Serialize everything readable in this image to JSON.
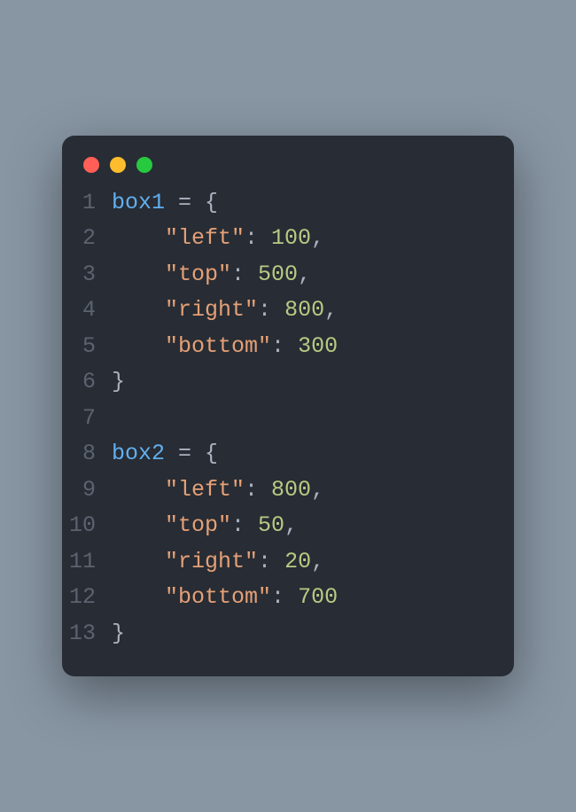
{
  "titlebar": {
    "buttons": [
      "close",
      "minimize",
      "zoom"
    ]
  },
  "code": {
    "lines": [
      {
        "n": "1",
        "tokens": [
          {
            "t": "box1",
            "c": "var"
          },
          {
            "t": " = ",
            "c": "op"
          },
          {
            "t": "{",
            "c": "brace"
          }
        ]
      },
      {
        "n": "2",
        "tokens": [
          {
            "t": "    ",
            "c": "op"
          },
          {
            "t": "\"left\"",
            "c": "str"
          },
          {
            "t": ": ",
            "c": "punc"
          },
          {
            "t": "100",
            "c": "num"
          },
          {
            "t": ",",
            "c": "punc"
          }
        ]
      },
      {
        "n": "3",
        "tokens": [
          {
            "t": "    ",
            "c": "op"
          },
          {
            "t": "\"top\"",
            "c": "str"
          },
          {
            "t": ": ",
            "c": "punc"
          },
          {
            "t": "500",
            "c": "num"
          },
          {
            "t": ",",
            "c": "punc"
          }
        ]
      },
      {
        "n": "4",
        "tokens": [
          {
            "t": "    ",
            "c": "op"
          },
          {
            "t": "\"right\"",
            "c": "str"
          },
          {
            "t": ": ",
            "c": "punc"
          },
          {
            "t": "800",
            "c": "num"
          },
          {
            "t": ",",
            "c": "punc"
          }
        ]
      },
      {
        "n": "5",
        "tokens": [
          {
            "t": "    ",
            "c": "op"
          },
          {
            "t": "\"bottom\"",
            "c": "str"
          },
          {
            "t": ": ",
            "c": "punc"
          },
          {
            "t": "300",
            "c": "num"
          }
        ]
      },
      {
        "n": "6",
        "tokens": [
          {
            "t": "}",
            "c": "brace"
          }
        ]
      },
      {
        "n": "7",
        "tokens": []
      },
      {
        "n": "8",
        "tokens": [
          {
            "t": "box2",
            "c": "var"
          },
          {
            "t": " = ",
            "c": "op"
          },
          {
            "t": "{",
            "c": "brace"
          }
        ]
      },
      {
        "n": "9",
        "tokens": [
          {
            "t": "    ",
            "c": "op"
          },
          {
            "t": "\"left\"",
            "c": "str"
          },
          {
            "t": ": ",
            "c": "punc"
          },
          {
            "t": "800",
            "c": "num"
          },
          {
            "t": ",",
            "c": "punc"
          }
        ]
      },
      {
        "n": "10",
        "tokens": [
          {
            "t": "    ",
            "c": "op"
          },
          {
            "t": "\"top\"",
            "c": "str"
          },
          {
            "t": ": ",
            "c": "punc"
          },
          {
            "t": "50",
            "c": "num"
          },
          {
            "t": ",",
            "c": "punc"
          }
        ]
      },
      {
        "n": "11",
        "tokens": [
          {
            "t": "    ",
            "c": "op"
          },
          {
            "t": "\"right\"",
            "c": "str"
          },
          {
            "t": ": ",
            "c": "punc"
          },
          {
            "t": "20",
            "c": "num"
          },
          {
            "t": ",",
            "c": "punc"
          }
        ]
      },
      {
        "n": "12",
        "tokens": [
          {
            "t": "    ",
            "c": "op"
          },
          {
            "t": "\"bottom\"",
            "c": "str"
          },
          {
            "t": ": ",
            "c": "punc"
          },
          {
            "t": "700",
            "c": "num"
          }
        ]
      },
      {
        "n": "13",
        "tokens": [
          {
            "t": "}",
            "c": "brace"
          }
        ]
      }
    ]
  }
}
